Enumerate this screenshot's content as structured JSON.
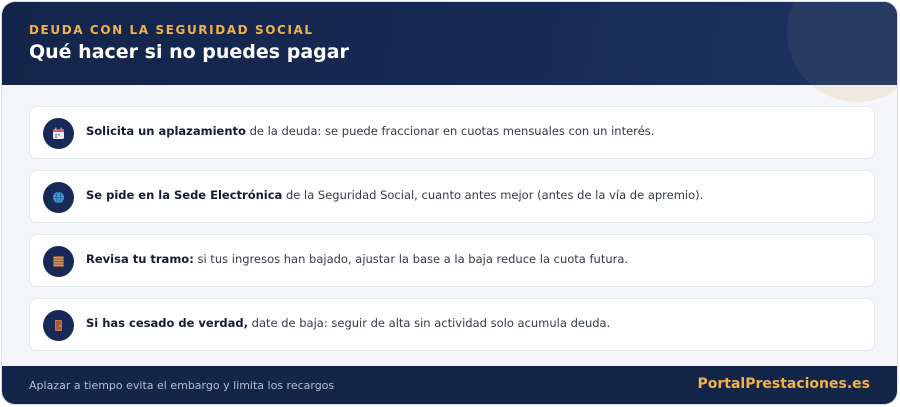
{
  "header": {
    "kicker": "DEUDA CON LA SEGURIDAD SOCIAL",
    "title": "Qué hacer si no puedes pagar"
  },
  "items": [
    {
      "icon": "calendar-icon",
      "strong": "Solicita un aplazamiento",
      "rest": " de la deuda: se puede fraccionar en cuotas mensuales con un interés."
    },
    {
      "icon": "globe-icon",
      "strong": "Se pide en la Sede Electrónica",
      "rest": " de la Seguridad Social, cuanto antes mejor (antes de la vía de apremio)."
    },
    {
      "icon": "abacus-icon",
      "strong": "Revisa tu tramo:",
      "rest": " si tus ingresos han bajado, ajustar la base a la baja reduce la cuota futura."
    },
    {
      "icon": "door-icon",
      "strong": "Si has cesado de verdad,",
      "rest": " date de baja: seguir de alta sin actividad solo acumula deuda."
    }
  ],
  "footer": {
    "note": "Aplazar a tiempo evita el embargo y limita los recargos",
    "brand": "PortalPrestaciones.es"
  },
  "colors": {
    "navy": "#172a55",
    "accent": "#f2b24a",
    "panel": "#f5f6fa"
  }
}
